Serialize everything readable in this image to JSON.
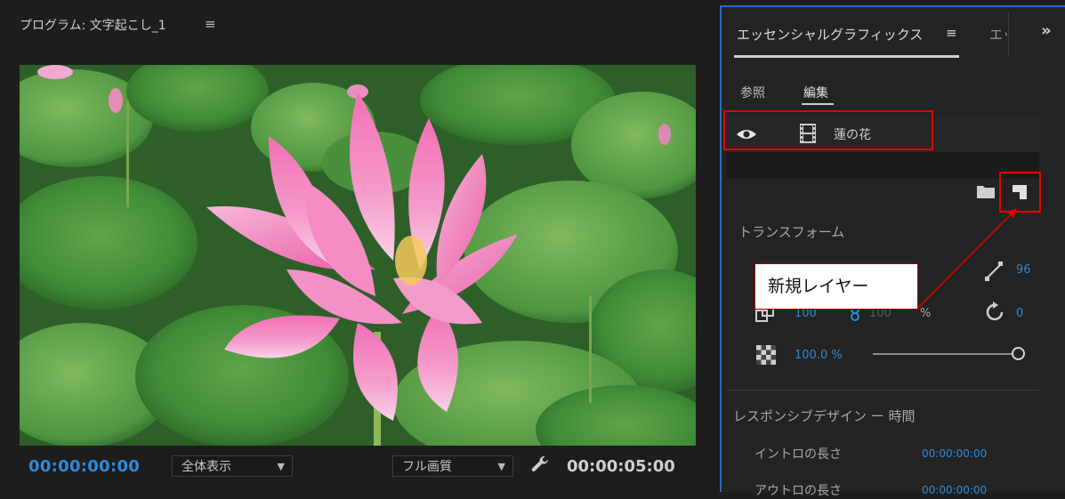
{
  "program_monitor": {
    "title": "プログラム: 文字起こし_1",
    "menu_glyph": "≡",
    "timecode_current": "00:00:00:00",
    "zoom_select": "全体表示",
    "quality_select": "フル画質",
    "timecode_duration": "00:00:05:00"
  },
  "essential_graphics": {
    "tab_title": "エッセンシャルグラフィックス",
    "tab_menu_glyph": "≡",
    "second_tab_partial": "エッセンシャル",
    "overflow_glyph": "»",
    "subtabs": {
      "browse": "参照",
      "edit": "編集"
    },
    "layer": {
      "name": "蓮の花"
    },
    "transform": {
      "title": "トランスフォーム",
      "position_partial": "96",
      "scale": "100",
      "scale_linked": "100",
      "percent": "%",
      "rotation": "0",
      "opacity": "100.0 %"
    },
    "responsive": {
      "title": "レスポンシブデザイン ー 時間",
      "intro_label": "イントロの長さ",
      "intro_value": "00:00:00:00",
      "outro_label": "アウトロの長さ",
      "outro_value": "00:00:00:00"
    }
  },
  "annotation": {
    "callout_text": "新規レイヤー",
    "highlight_color": "#e30000"
  },
  "colors": {
    "accent_blue": "#2f8bd8",
    "panel_bg": "#232323",
    "app_bg": "#1d1d1d"
  }
}
